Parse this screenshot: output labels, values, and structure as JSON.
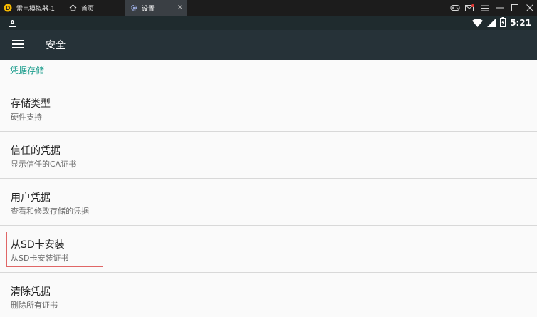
{
  "titlebar": {
    "app_name": "雷电模拟器-1",
    "tabs": [
      {
        "label": "首页",
        "icon": "home-icon"
      },
      {
        "label": "设置",
        "icon": "gear-icon",
        "active": true
      }
    ],
    "close_glyph": "×",
    "window_buttons": [
      "gamepad-icon",
      "mail-icon",
      "menu-icon",
      "minimize-icon",
      "maximize-icon",
      "close-icon"
    ]
  },
  "statusbar": {
    "left_badge": "A",
    "time": "5:21"
  },
  "appbar": {
    "title": "安全"
  },
  "category": {
    "title": "凭据存储"
  },
  "preferences": [
    {
      "title": "存储类型",
      "summary": "硬件支持"
    },
    {
      "title": "信任的凭据",
      "summary": "显示信任的CA证书"
    },
    {
      "title": "用户凭据",
      "summary": "查看和修改存储的凭据"
    },
    {
      "title": "从SD卡安装",
      "summary": "从SD卡安装证书",
      "highlighted": true
    },
    {
      "title": "清除凭据",
      "summary": "删除所有证书"
    }
  ],
  "colors": {
    "accent": "#1e9e8e",
    "appbar": "#263238",
    "highlight_border": "#e06666"
  }
}
